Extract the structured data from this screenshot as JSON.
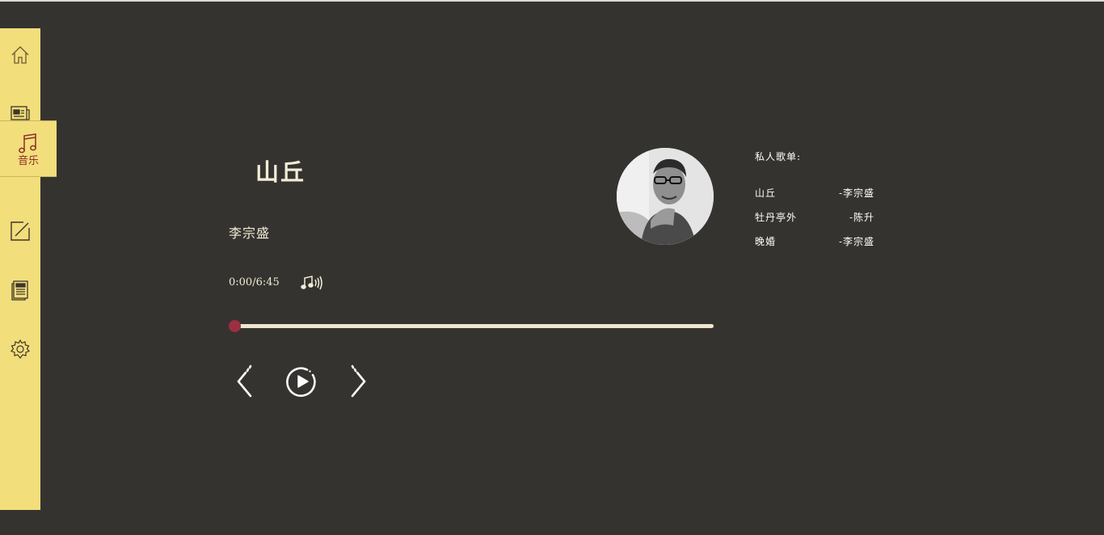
{
  "sidebar": {
    "items": [
      {
        "icon": "home-icon"
      },
      {
        "icon": "news-icon"
      },
      {
        "icon": "music-note-icon",
        "label": "音乐",
        "active": true
      },
      {
        "icon": "edit-icon"
      },
      {
        "icon": "document-icon"
      },
      {
        "icon": "gear-icon"
      }
    ],
    "bg_color": "#f2de7b",
    "icon_color": "#6b5a33",
    "active_color": "#8e2c2c"
  },
  "player": {
    "title": "山丘",
    "artist": "李宗盛",
    "time": "0:00/6:45",
    "progress": 0.0,
    "accent_color": "#9c2f43"
  },
  "playlist": {
    "title": "私人歌单:",
    "songs": [
      {
        "name": "山丘",
        "artist": "-李宗盛"
      },
      {
        "name": "牡丹亭外",
        "artist": "-陈升"
      },
      {
        "name": "晚婚",
        "artist": "-李宗盛"
      }
    ]
  }
}
